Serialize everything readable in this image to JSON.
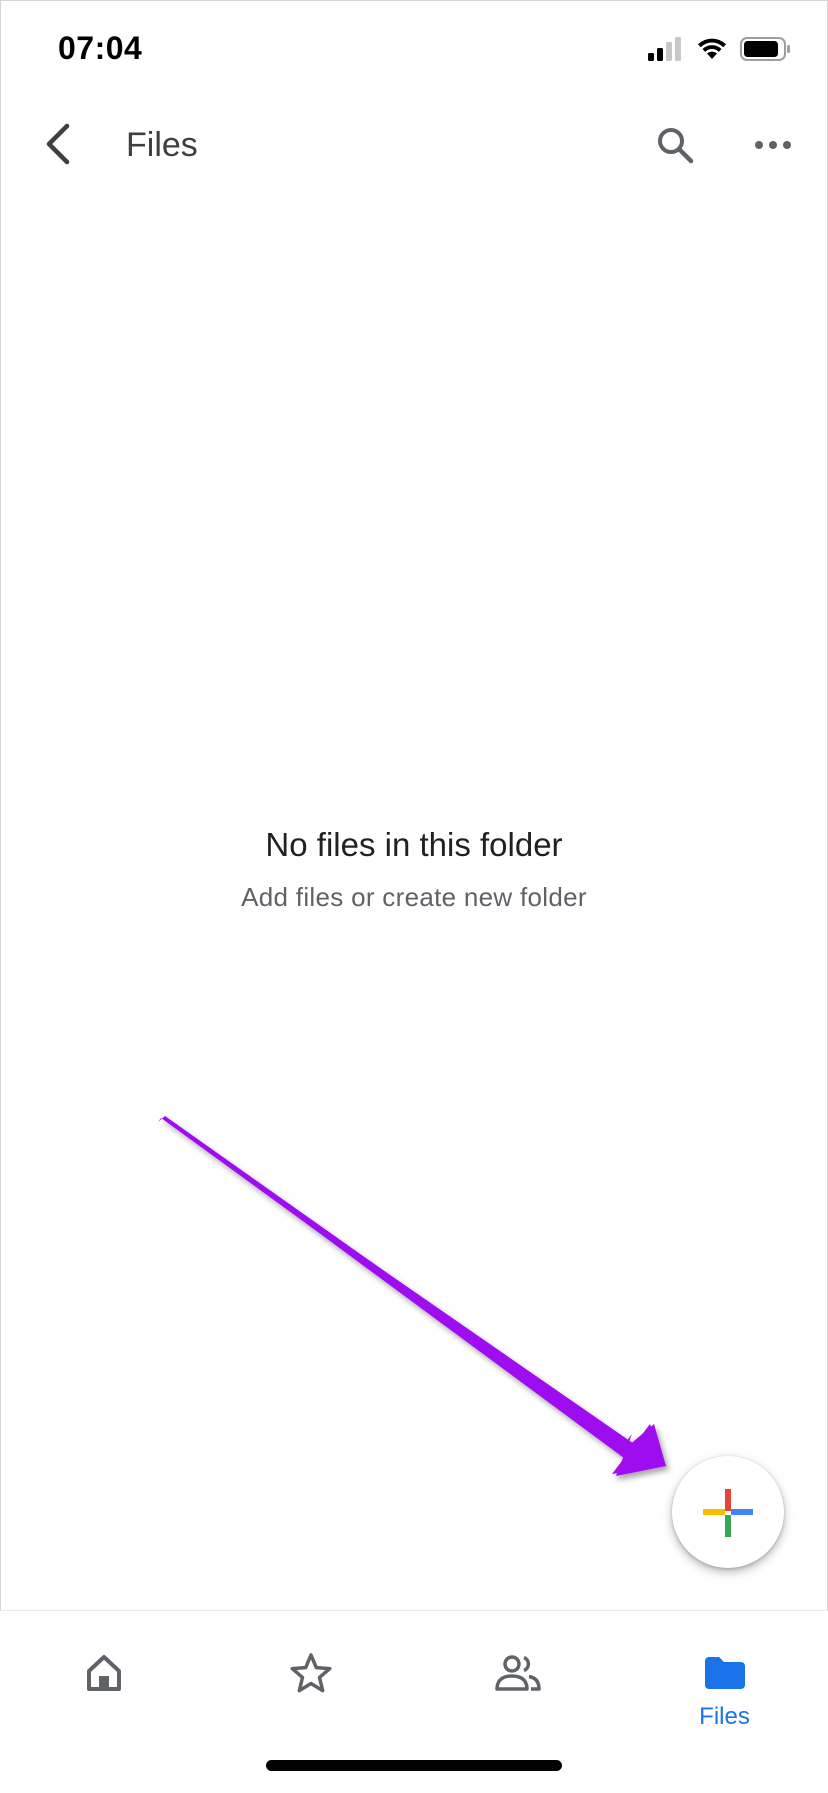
{
  "status_bar": {
    "time": "07:04"
  },
  "app_bar": {
    "title": "Files"
  },
  "empty_state": {
    "title": "No files in this folder",
    "subtitle": "Add files or create new folder"
  },
  "bottom_nav": {
    "items": [
      {
        "id": "home",
        "icon": "home-icon",
        "label": ""
      },
      {
        "id": "starred",
        "icon": "star-icon",
        "label": ""
      },
      {
        "id": "shared",
        "icon": "people-icon",
        "label": ""
      },
      {
        "id": "files",
        "icon": "folder-icon",
        "label": "Files",
        "active": true
      }
    ]
  },
  "colors": {
    "accent": "#1a73e8",
    "annotation_arrow": "#9d10f0",
    "plus_red": "#ea4335",
    "plus_blue": "#4285f4",
    "plus_green": "#34a853",
    "plus_yellow": "#fbbc04"
  }
}
